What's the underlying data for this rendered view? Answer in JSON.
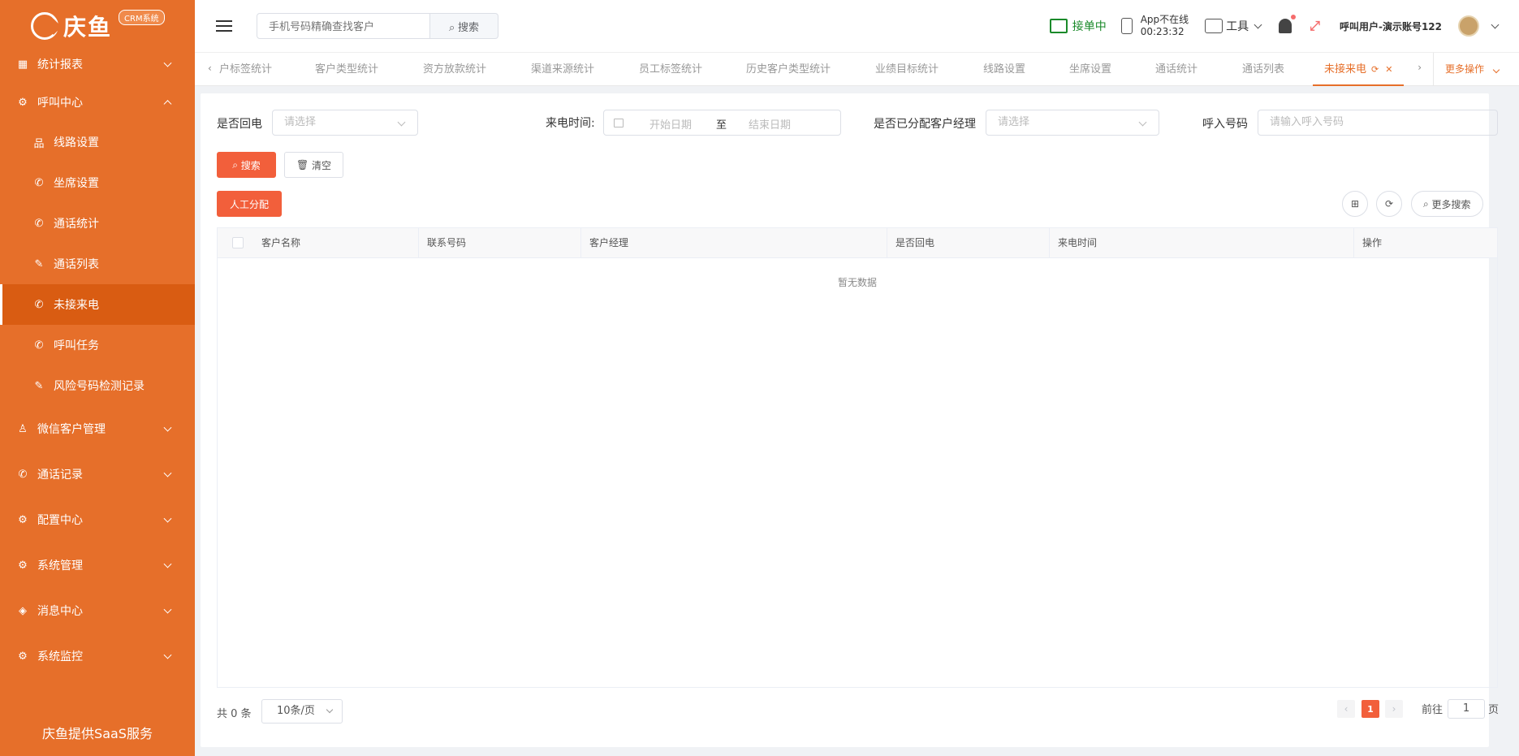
{
  "brand": {
    "name": "庆鱼",
    "badge": "CRM系统",
    "footer": "庆鱼提供SaaS服务"
  },
  "sidebar": {
    "items": [
      {
        "label": "统计报表",
        "icon": "table-icon",
        "expanded": false
      },
      {
        "label": "呼叫中心",
        "icon": "gear-icon",
        "expanded": true
      },
      {
        "label": "微信客户管理",
        "icon": "user-icon",
        "expanded": false
      },
      {
        "label": "通话记录",
        "icon": "phone-icon",
        "expanded": false
      },
      {
        "label": "配置中心",
        "icon": "gear-icon",
        "expanded": false
      },
      {
        "label": "系统管理",
        "icon": "gear-icon",
        "expanded": false
      },
      {
        "label": "消息中心",
        "icon": "tag-icon",
        "expanded": false
      },
      {
        "label": "系统监控",
        "icon": "gear-icon",
        "expanded": false
      }
    ],
    "subitems": [
      {
        "label": "线路设置",
        "icon": "network-icon"
      },
      {
        "label": "坐席设置",
        "icon": "phone-icon"
      },
      {
        "label": "通话统计",
        "icon": "phone-call-icon"
      },
      {
        "label": "通话列表",
        "icon": "edit-list-icon"
      },
      {
        "label": "未接来电",
        "icon": "phone-call-icon",
        "active": true
      },
      {
        "label": "呼叫任务",
        "icon": "phone-icon"
      },
      {
        "label": "风险号码检测记录",
        "icon": "edit-list-icon"
      }
    ]
  },
  "header": {
    "search_placeholder": "手机号码精确查找客户",
    "search_button": "搜索",
    "call_status": "接单中",
    "app_status": "App不在线",
    "app_timer": "00:23:32",
    "tools_label": "工具",
    "user_label": "呼叫用户-演示账号122",
    "accent_color": "#e66f2a",
    "status_color": "#1a8a2a"
  },
  "tabs": {
    "items": [
      "户标签统计",
      "客户类型统计",
      "资方放款统计",
      "渠道来源统计",
      "员工标签统计",
      "历史客户类型统计",
      "业绩目标统计",
      "线路设置",
      "坐席设置",
      "通话统计",
      "通话列表"
    ],
    "active": "未接来电",
    "more": "更多操作"
  },
  "filters": {
    "callback_label": "是否回电",
    "callback_placeholder": "请选择",
    "time_label": "来电时间:",
    "start_placeholder": "开始日期",
    "range_sep": "至",
    "end_placeholder": "结束日期",
    "assigned_label": "是否已分配客户经理",
    "assigned_placeholder": "请选择",
    "number_label": "呼入号码",
    "number_placeholder": "请输入呼入号码"
  },
  "actions": {
    "search": "搜索",
    "clear": "清空",
    "assign": "人工分配",
    "more_search": "更多搜索"
  },
  "table": {
    "columns": [
      "客户名称",
      "联系号码",
      "客户经理",
      "是否回电",
      "来电时间",
      "操作"
    ],
    "empty_text": "暂无数据"
  },
  "pagination": {
    "total": "共 0 条",
    "page_size": "10条/页",
    "current": "1",
    "goto_label": "前往",
    "goto_value": "1",
    "page_unit": "页"
  }
}
